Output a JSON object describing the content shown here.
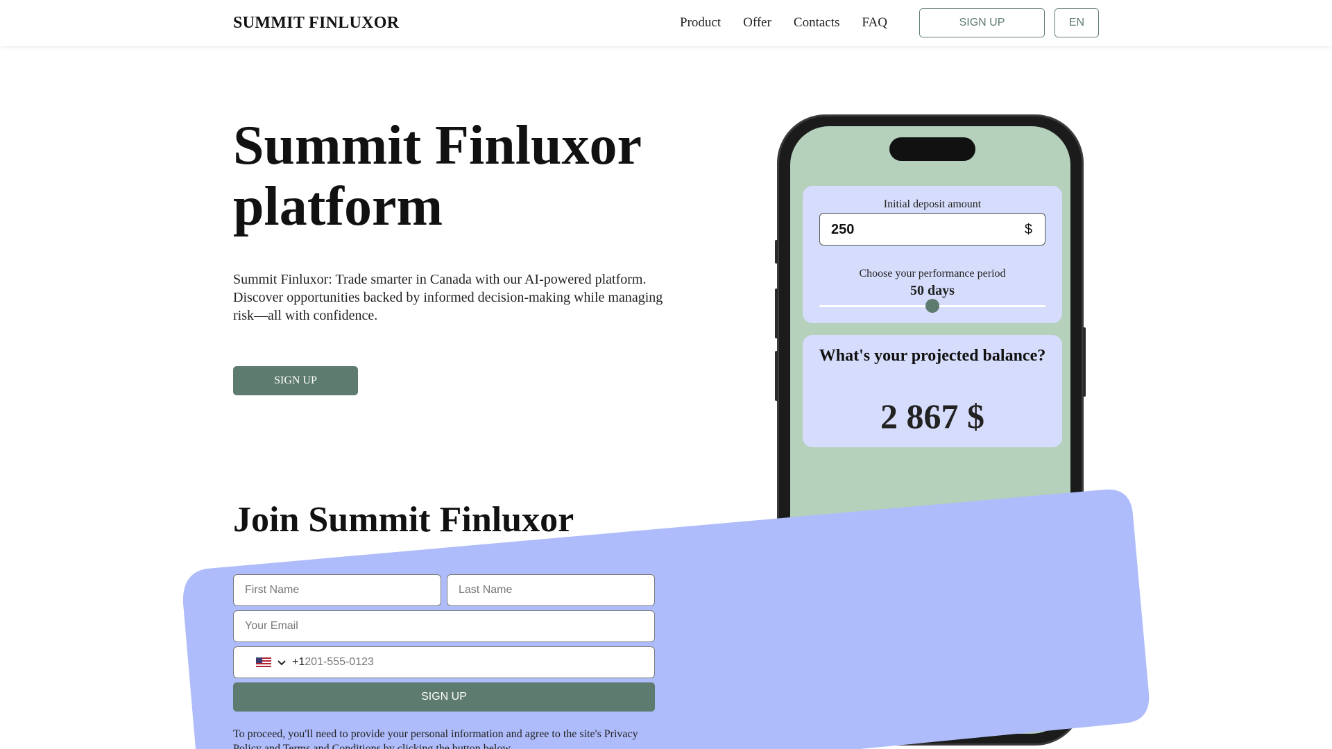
{
  "header": {
    "logo": "SUMMIT FINLUXOR",
    "nav": [
      "Product",
      "Offer",
      "Contacts",
      "FAQ"
    ],
    "signup_label": "SIGN UP",
    "lang_label": "EN"
  },
  "hero": {
    "title": "Summit Finluxor platform",
    "description": "Summit Finluxor: Trade smarter in Canada with our AI-powered platform. Discover opportunities backed by informed decision-making while managing risk—all with confidence.",
    "cta_label": "SIGN UP"
  },
  "calculator": {
    "deposit_label": "Initial deposit amount",
    "deposit_value": "250",
    "deposit_currency": "$",
    "period_label": "Choose your performance period",
    "period_value": "50 days",
    "period_fraction": 0.5,
    "projected_title": "What's your projected balance?",
    "projected_value": "2 867 $"
  },
  "form": {
    "title": "Join Summit Finluxor",
    "first_name_placeholder": "First Name",
    "last_name_placeholder": "Last Name",
    "email_placeholder": "Your Email",
    "dial_code": "+1",
    "phone_placeholder": "201-555-0123",
    "submit_label": "SIGN UP",
    "disclaimer": "To proceed, you'll need to provide your personal information and agree to the site's Privacy Policy and Terms and Conditions by clicking the button below."
  },
  "colors": {
    "accent": "#5e7b6f",
    "shape": "#afbcfb",
    "card": "#d6dcfb",
    "phone_screen": "#b5d0bb"
  },
  "icons": [
    "us-flag-icon",
    "chevron-down-icon"
  ]
}
